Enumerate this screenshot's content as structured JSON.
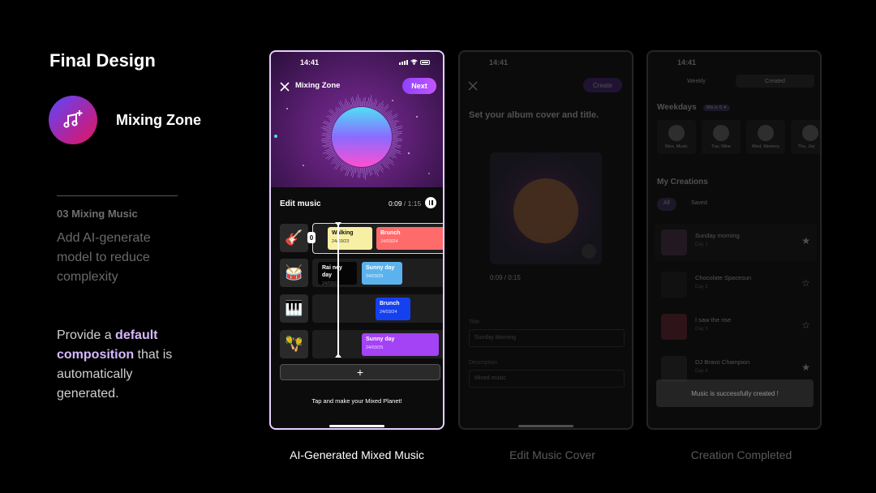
{
  "page": {
    "title": "Final Design",
    "feature_name": "Mixing Zone",
    "step_label": "03 Mixing Music",
    "step_description": "Add AI-generate model to reduce complexity",
    "provide_pre": "Provide a ",
    "provide_bold": "default composition",
    "provide_post": " that is automatically generated."
  },
  "captions": {
    "main": "AI-Generated Mixed Music",
    "cover": "Edit Music Cover",
    "completed": "Creation Completed"
  },
  "main_phone": {
    "time": "14:41",
    "title": "Mixing Zone",
    "next_label": "Next",
    "edit_title": "Edit music",
    "time_current": "0:09",
    "time_total": " / 1:15",
    "handle_label": "0",
    "add_label": "+",
    "tap_text": "Tap and make your Mixed Planet!",
    "tracks": [
      {
        "icon": "guitar-icon",
        "glyph": "🎸",
        "clips": [
          {
            "name": "Walking",
            "date": "24/03/23",
            "color": "#f7f0a4",
            "text": "#111"
          },
          {
            "name": "Brunch",
            "date": "24/03/24",
            "color": "#ff6b6b",
            "text": "#fff"
          }
        ]
      },
      {
        "icon": "drum-icon",
        "glyph": "🥁",
        "clips": [
          {
            "name": "Rai ney day",
            "date": "24/03/22",
            "color": "#050505",
            "text": "#fff"
          },
          {
            "name": "Sunny day",
            "date": "24/03/25",
            "color": "#5bb3ee",
            "text": "#fff"
          }
        ]
      },
      {
        "icon": "piano-icon",
        "glyph": "🎹",
        "clips": [
          {
            "name": "Brunch",
            "date": "24/03/24",
            "color": "#1540f0",
            "text": "#fff"
          }
        ]
      },
      {
        "icon": "maracas-icon",
        "glyph": "🪇",
        "clips": [
          {
            "name": "Sunny day",
            "date": "24/03/25",
            "color": "#a442f5",
            "text": "#fff"
          }
        ]
      }
    ]
  },
  "cover_phone": {
    "time": "14:41",
    "create_label": "Create",
    "heading": "Set your album cover and title.",
    "timer": "0:09 / 0:15",
    "title_label": "Title",
    "title_value": "Sunday Morning",
    "desc_label": "Description",
    "desc_value": "Mixed music"
  },
  "completed_phone": {
    "time": "14:41",
    "tabs": [
      "Weekly",
      "Created"
    ],
    "weekdays_heading": "Weekdays",
    "weekdays_badge": "Mix in 5 ✦",
    "tiles": [
      "Mon, Music",
      "Tue, Mine",
      "Wed, Memory",
      "Thu, Joy"
    ],
    "creations_heading": "My Creations",
    "chips": [
      "All",
      "Saved"
    ],
    "rows": [
      {
        "title": "Sunday morning",
        "sub": "Day 1",
        "star": "★"
      },
      {
        "title": "Chocolate Spacesun",
        "sub": "Day 2",
        "star": "☆"
      },
      {
        "title": "I saw the rise",
        "sub": "Day 3",
        "star": "☆"
      },
      {
        "title": "DJ Bravo Champion",
        "sub": "Day 4",
        "star": "★"
      }
    ],
    "toast": "Music is successfully created !"
  }
}
